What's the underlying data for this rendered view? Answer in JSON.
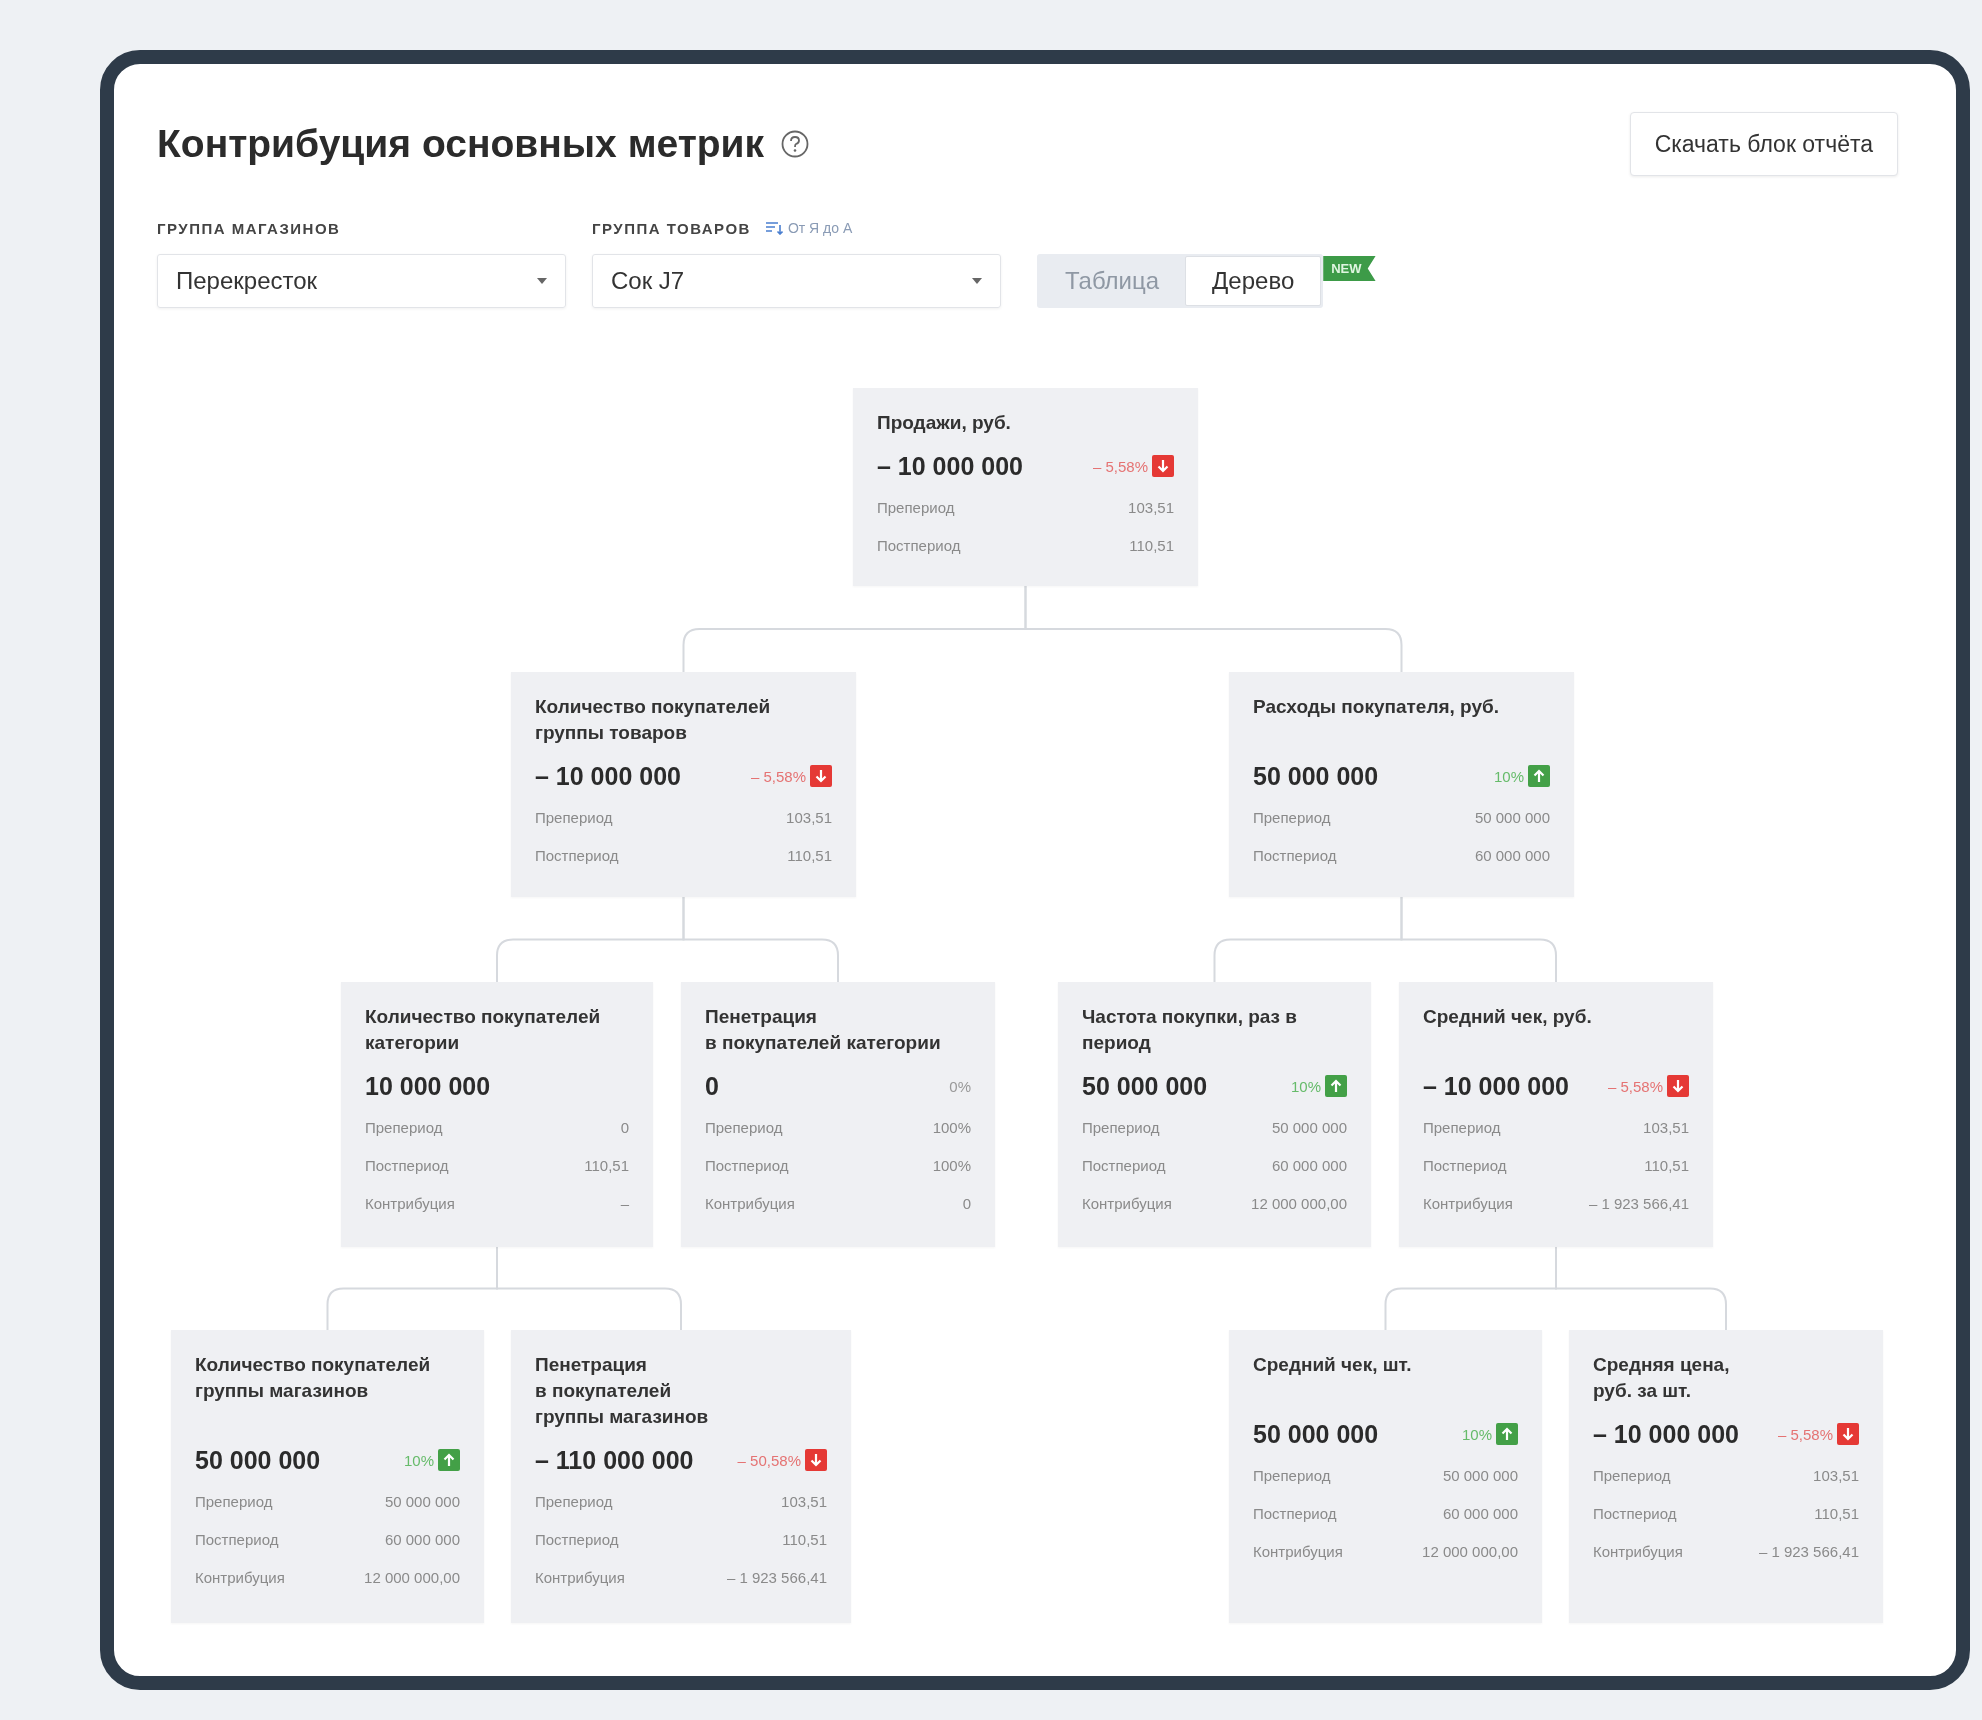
{
  "title": "Контрибуция основных метрик",
  "download_button": "Скачать блок отчёта",
  "filters": [
    {
      "label": "ГРУППА МАГАЗИНОВ",
      "value": "Перекресток"
    },
    {
      "label": "ГРУППА ТОВАРОВ",
      "sort": "От Я до А",
      "value": "Сок J7"
    }
  ],
  "view_tabs": [
    {
      "label": "Таблица",
      "selected": false
    },
    {
      "label": "Дерево",
      "selected": true,
      "badge": "NEW"
    }
  ],
  "tree": {
    "title_lines": [
      "Продажи, руб."
    ],
    "value": "– 10 000 000",
    "change": {
      "text": "– 5,58%",
      "kind": "down"
    },
    "rows": [
      {
        "label": "Препериод",
        "value": "103,51"
      },
      {
        "label": "Постпериод",
        "value": "110,51"
      }
    ],
    "children": [
      {
        "title_lines": [
          "Количество покупателей",
          "группы товаров"
        ],
        "value": "– 10 000 000",
        "change": {
          "text": "– 5,58%",
          "kind": "down"
        },
        "rows": [
          {
            "label": "Препериод",
            "value": "103,51"
          },
          {
            "label": "Постпериод",
            "value": "110,51"
          }
        ],
        "children": [
          {
            "title_lines": [
              "Количество покупателей",
              "категории"
            ],
            "value": "10 000 000",
            "rows": [
              {
                "label": "Препериод",
                "value": "0"
              },
              {
                "label": "Постпериод",
                "value": "110,51"
              },
              {
                "label": "Контрибуция",
                "value": "–"
              }
            ],
            "children": [
              {
                "title_lines": [
                  "Количество покупателей",
                  "группы магазинов"
                ],
                "value": "50 000 000",
                "change": {
                  "text": "10%",
                  "kind": "up"
                },
                "rows": [
                  {
                    "label": "Препериод",
                    "value": "50 000 000"
                  },
                  {
                    "label": "Постпериод",
                    "value": "60 000 000"
                  },
                  {
                    "label": "Контрибуция",
                    "value": "12 000 000,00"
                  }
                ]
              },
              {
                "title_lines": [
                  "Пенетрация",
                  "в покупателей",
                  "группы магазинов"
                ],
                "value": "– 110 000 000",
                "change": {
                  "text": "– 50,58%",
                  "kind": "down"
                },
                "rows": [
                  {
                    "label": "Препериод",
                    "value": "103,51"
                  },
                  {
                    "label": "Постпериод",
                    "value": "110,51"
                  },
                  {
                    "label": "Контрибуция",
                    "value": "– 1 923 566,41"
                  }
                ]
              }
            ]
          },
          {
            "title_lines": [
              "Пенетрация",
              "в покупателей категории"
            ],
            "value": "0",
            "change": {
              "text": "0%",
              "kind": "flat"
            },
            "rows": [
              {
                "label": "Препериод",
                "value": "100%"
              },
              {
                "label": "Постпериод",
                "value": "100%"
              },
              {
                "label": "Контрибуция",
                "value": "0"
              }
            ]
          }
        ]
      },
      {
        "title_lines": [
          "Расходы покупателя, руб."
        ],
        "value": "50 000 000",
        "change": {
          "text": "10%",
          "kind": "up"
        },
        "rows": [
          {
            "label": "Препериод",
            "value": "50 000 000"
          },
          {
            "label": "Постпериод",
            "value": "60 000 000"
          }
        ],
        "children": [
          {
            "title_lines": [
              "Частота покупки, раз в",
              "период"
            ],
            "value": "50 000 000",
            "change": {
              "text": "10%",
              "kind": "up"
            },
            "rows": [
              {
                "label": "Препериод",
                "value": "50 000 000"
              },
              {
                "label": "Постпериод",
                "value": "60 000 000"
              },
              {
                "label": "Контрибуция",
                "value": "12 000 000,00"
              }
            ]
          },
          {
            "title_lines": [
              "Средний чек, руб."
            ],
            "value": "– 10 000 000",
            "change": {
              "text": "– 5,58%",
              "kind": "down"
            },
            "rows": [
              {
                "label": "Препериод",
                "value": "103,51"
              },
              {
                "label": "Постпериод",
                "value": "110,51"
              },
              {
                "label": "Контрибуция",
                "value": "– 1 923 566,41"
              }
            ],
            "children": [
              {
                "title_lines": [
                  "Средний чек, шт."
                ],
                "value": "50 000 000",
                "change": {
                  "text": "10%",
                  "kind": "up"
                },
                "rows": [
                  {
                    "label": "Препериод",
                    "value": "50 000 000"
                  },
                  {
                    "label": "Постпериод",
                    "value": "60 000 000"
                  },
                  {
                    "label": "Контрибуция",
                    "value": "12 000 000,00"
                  }
                ]
              },
              {
                "title_lines": [
                  "Средняя цена,",
                  "руб. за шт."
                ],
                "value": "– 10 000 000",
                "change": {
                  "text": "– 5,58%",
                  "kind": "down"
                },
                "rows": [
                  {
                    "label": "Препериод",
                    "value": "103,51"
                  },
                  {
                    "label": "Постпериод",
                    "value": "110,51"
                  },
                  {
                    "label": "Контрибуция",
                    "value": "– 1 923 566,41"
                  }
                ]
              }
            ]
          }
        ]
      }
    ]
  }
}
